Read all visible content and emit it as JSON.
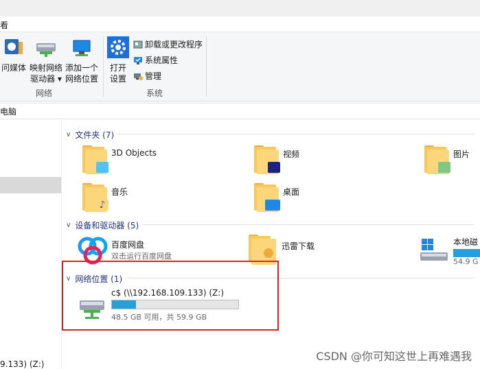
{
  "menu": {
    "view_label": "看"
  },
  "ribbon": {
    "network_group_label": "网络",
    "system_group_label": "系统",
    "btn_media": "问媒体",
    "btn_map_line1": "映射网络",
    "btn_map_line2": "驱动器 ▾",
    "btn_add_line1": "添加一个",
    "btn_add_line2": "网络位置",
    "btn_open_line1": "打开",
    "btn_open_line2": "设置",
    "small_uninstall": "卸载或更改程序",
    "small_sysprops": "系统属性",
    "small_manage": "管理"
  },
  "address": {
    "path": "电脑"
  },
  "nav": {
    "bottom_item": "9.133) (Z:)"
  },
  "sections": {
    "folders": {
      "title": "文件夹 (7)"
    },
    "devices": {
      "title": "设备和驱动器 (5)"
    },
    "network": {
      "title": "网络位置 (1)"
    }
  },
  "folders": [
    {
      "name": "3D Objects"
    },
    {
      "name": "视频"
    },
    {
      "name": "图片"
    },
    {
      "name": "音乐"
    },
    {
      "name": "桌面"
    }
  ],
  "devices": [
    {
      "name": "百度网盘",
      "sub": "双击运行百度网盘"
    },
    {
      "name": "迅雷下载"
    },
    {
      "name": "本地磁",
      "sub": "54.9 G"
    }
  ],
  "network_drive": {
    "name": "c$ (\\\\192.168.109.133) (Z:)",
    "usage_text": "48.5 GB 可用，共 59.9 GB",
    "used_fraction": 0.19
  },
  "watermark": "CSDN @你可知这世上再难遇我",
  "colors": {
    "accent": "#26a0da",
    "highlight_box": "#e02020",
    "section_title": "#1e3287"
  }
}
